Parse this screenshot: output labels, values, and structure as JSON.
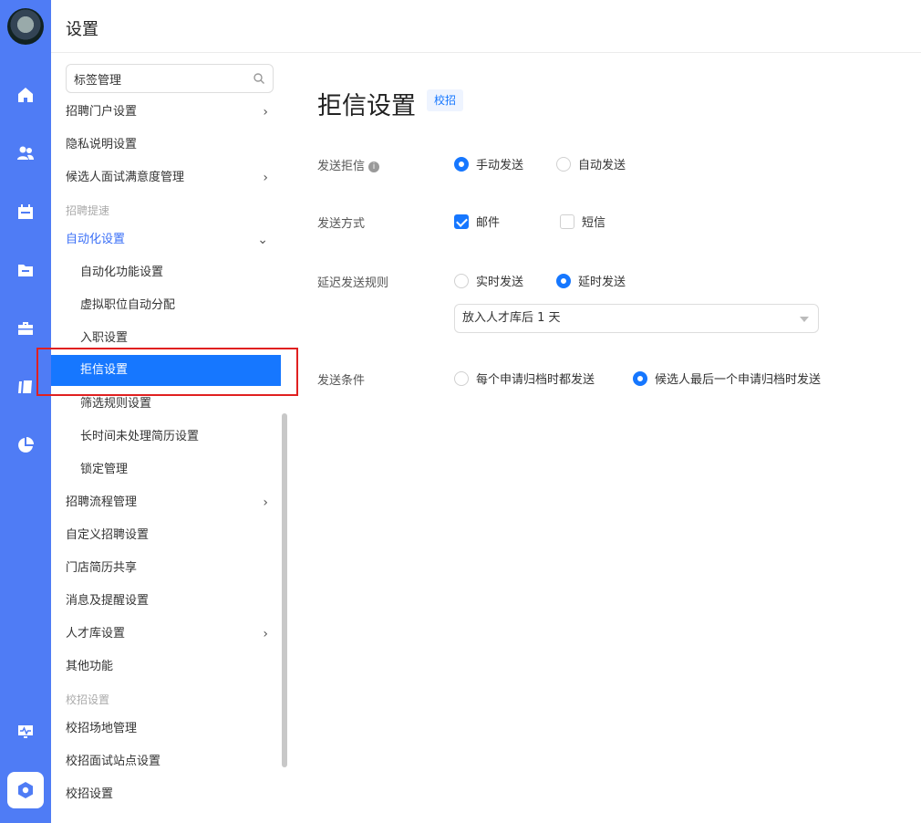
{
  "header": {
    "title": "设置"
  },
  "search": {
    "value": "标签管理"
  },
  "sidebar": {
    "items": [
      {
        "label": "招聘门户设置",
        "chevron": "›"
      },
      {
        "label": "隐私说明设置"
      },
      {
        "label": "候选人面试满意度管理",
        "chevron": "›"
      },
      {
        "label": "招聘提速",
        "section": true
      },
      {
        "label": "自动化设置",
        "chevron": "⌄"
      },
      {
        "label": "自动化功能设置"
      },
      {
        "label": "虚拟职位自动分配"
      },
      {
        "label": "入职设置"
      },
      {
        "label": "拒信设置"
      },
      {
        "label": "筛选规则设置"
      },
      {
        "label": "长时间未处理简历设置"
      },
      {
        "label": "锁定管理"
      },
      {
        "label": "招聘流程管理",
        "chevron": "›"
      },
      {
        "label": "自定义招聘设置"
      },
      {
        "label": "门店简历共享"
      },
      {
        "label": "消息及提醒设置"
      },
      {
        "label": "人才库设置",
        "chevron": "›"
      },
      {
        "label": "其他功能"
      },
      {
        "label": "校招设置",
        "section": true
      },
      {
        "label": "校招场地管理"
      },
      {
        "label": "校招面试站点设置"
      },
      {
        "label": "校招设置"
      }
    ]
  },
  "main": {
    "title": "拒信设置",
    "tag": "校招",
    "info_glyph": "i",
    "send_rejection": {
      "label": "发送拒信",
      "options": [
        "手动发送",
        "自动发送"
      ],
      "selected": "手动发送"
    },
    "send_method": {
      "label": "发送方式",
      "options": [
        "邮件",
        "短信"
      ],
      "checked": [
        "邮件"
      ]
    },
    "delay_rule": {
      "label": "延迟发送规则",
      "options": [
        "实时发送",
        "延时发送"
      ],
      "selected": "延时发送",
      "select_value": "放入人才库后 1 天"
    },
    "send_condition": {
      "label": "发送条件",
      "options": [
        "每个申请归档时都发送",
        "候选人最后一个申请归档时发送"
      ],
      "selected": "候选人最后一个申请归档时发送"
    }
  },
  "colors": {
    "rail": "#4f7cf5",
    "accent": "#1677ff",
    "highlight": "#e02020"
  }
}
